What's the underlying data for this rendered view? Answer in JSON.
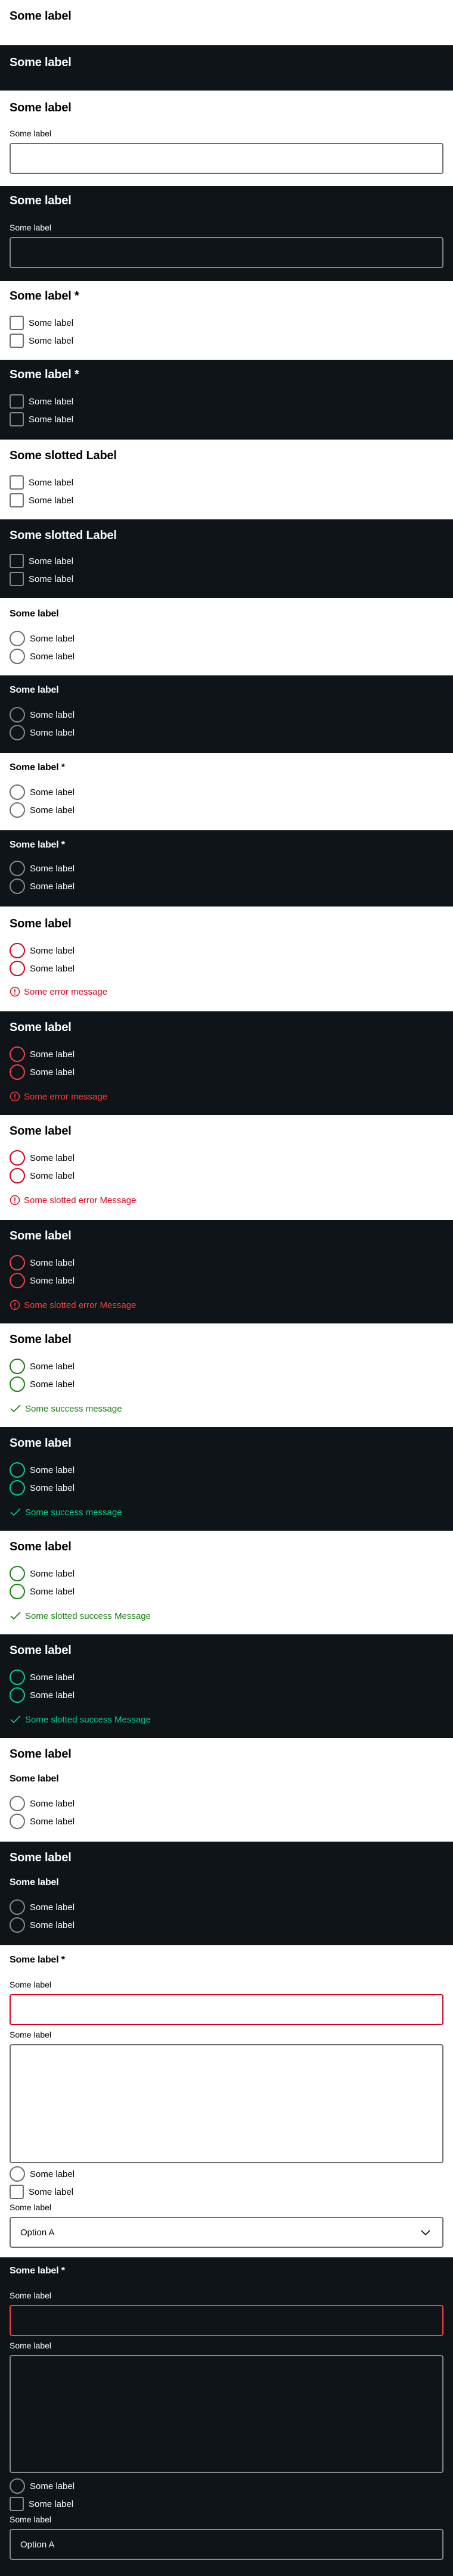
{
  "texts": {
    "legend": "Some label",
    "legend_required": "Some label *",
    "legend_slotted": "Some slotted Label",
    "label": "Some label",
    "option": "Some label",
    "error_message": "Some error message",
    "slotted_error_message": "Some slotted error Message",
    "success_message": "Some success message",
    "slotted_success_message": "Some slotted success Message",
    "select_value": "Option A"
  },
  "icons": {
    "error": "exclamation-circle-icon",
    "success": "check-icon",
    "select": "chevron-down-icon"
  },
  "colors": {
    "light_background": "#ffffff",
    "dark_background": "#0e1418",
    "error_light": "#d5001c",
    "error_dark": "#fc4040",
    "success_light": "#197e10",
    "success_dark": "#09d087",
    "border": "#6b6d70"
  }
}
